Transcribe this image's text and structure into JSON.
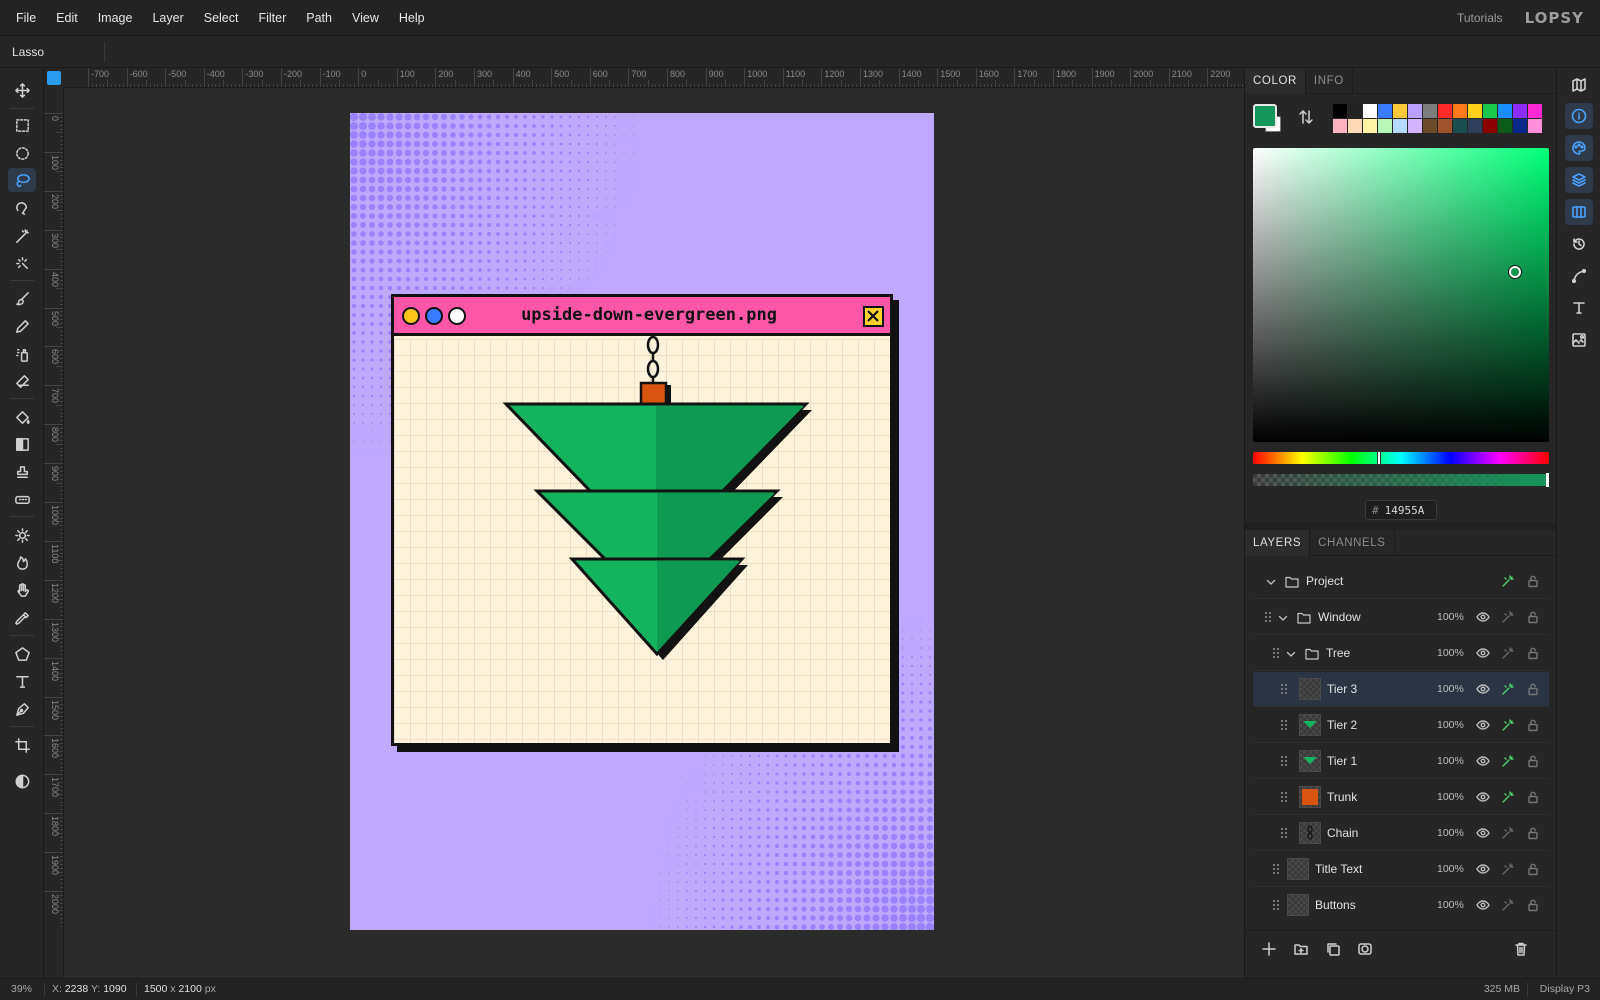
{
  "menu": {
    "items": [
      "File",
      "Edit",
      "Image",
      "Layer",
      "Select",
      "Filter",
      "Path",
      "View",
      "Help"
    ],
    "tutorials": "Tutorials",
    "logo": "LOPSY"
  },
  "options_bar": {
    "tool_name": "Lasso"
  },
  "rulers": {
    "horizontal": [
      "-700",
      "-600",
      "-500",
      "-400",
      "-300",
      "-200",
      "-100",
      "0",
      "100",
      "200",
      "300",
      "400",
      "500",
      "600",
      "700",
      "800",
      "900",
      "1000",
      "1100",
      "1200",
      "1300",
      "1400",
      "1500",
      "1600",
      "1700",
      "1800",
      "1900",
      "2000",
      "2100",
      "2200"
    ],
    "vertical": [
      "0",
      "100",
      "200",
      "300",
      "400",
      "500",
      "600",
      "700",
      "800",
      "900",
      "1000",
      "1100",
      "1200",
      "1300",
      "1400",
      "1500",
      "1600",
      "1700",
      "1800",
      "1900",
      "2000"
    ]
  },
  "toolbar": {
    "tools": [
      "move-icon",
      "rect-select-icon",
      "ellipse-select-icon",
      "lasso-icon",
      "magnetic-lasso-icon",
      "magic-wand-icon",
      "quick-select-icon",
      "brush-icon",
      "pencil-icon",
      "spray-icon",
      "eraser-icon",
      "fill-icon",
      "gradient-icon",
      "stamp-icon",
      "healing-icon",
      "dodge-icon",
      "burn-icon",
      "hand-icon",
      "eyedropper-icon",
      "polygon-icon",
      "text-icon",
      "pen-icon",
      "crop-icon",
      "contrast-icon"
    ],
    "active": "lasso-icon"
  },
  "document": {
    "window_title": "upside-down-evergreen.png",
    "colors": {
      "background": "#BFA9FF",
      "titlebar": "#FF56A8",
      "paper": "#FFF3DC",
      "tree": "#14B35F",
      "tree_dark": "#0E9A52",
      "trunk": "#D9540E",
      "outline": "#121212"
    },
    "buttons": [
      "yellow",
      "blue",
      "white"
    ]
  },
  "color_panel": {
    "tabs": [
      "COLOR",
      "INFO"
    ],
    "active_tab": "COLOR",
    "foreground": "#14955A",
    "background": "#FFFFFF",
    "hex_label": "#",
    "hex_value": "14955A",
    "palette": [
      "#000000",
      "#222222",
      "#ffffff",
      "#3b7bff",
      "#ffc83a",
      "#b9a0ff",
      "#7d7d7d",
      "#ff2a2a",
      "#ff7a1a",
      "#ffd21a",
      "#19c74a",
      "#1a8dff",
      "#8c2dff",
      "#ff2ad4",
      "#ffb3c1",
      "#ffd9b3",
      "#fff3a6",
      "#b8f5b8",
      "#b3d9ff",
      "#d4b3ff",
      "#6b4a2a",
      "#a0522d",
      "#1a4f4f",
      "#2f3f5a",
      "#8b0000",
      "#0a5c1a",
      "#0a2a8b",
      "#ff8fd8"
    ]
  },
  "layers_panel": {
    "tabs": [
      "LAYERS",
      "CHANNELS"
    ],
    "active_tab": "LAYERS",
    "layers": [
      {
        "name": "Project",
        "type": "folder",
        "depth": 0,
        "opacity": ""
      },
      {
        "name": "Window",
        "type": "folder",
        "depth": 1,
        "opacity": "100%"
      },
      {
        "name": "Tree",
        "type": "folder",
        "depth": 2,
        "opacity": "100%"
      },
      {
        "name": "Tier 3",
        "type": "layer",
        "depth": 3,
        "opacity": "100%",
        "selected": true
      },
      {
        "name": "Tier 2",
        "type": "layer",
        "depth": 3,
        "opacity": "100%"
      },
      {
        "name": "Tier 1",
        "type": "layer",
        "depth": 3,
        "opacity": "100%"
      },
      {
        "name": "Trunk",
        "type": "layer",
        "depth": 3,
        "opacity": "100%"
      },
      {
        "name": "Chain",
        "type": "layer",
        "depth": 3,
        "opacity": "100%"
      },
      {
        "name": "Title Text",
        "type": "layer",
        "depth": 2,
        "opacity": "100%"
      },
      {
        "name": "Buttons",
        "type": "layer",
        "depth": 2,
        "opacity": "100%"
      }
    ]
  },
  "status": {
    "zoom": "39%",
    "x_label": "X:",
    "x_value": "2238",
    "y_label": "Y:",
    "y_value": "1090",
    "width": "1500",
    "size_sep": "x",
    "height": "2100",
    "unit": "px",
    "memory": "325 MB",
    "color_profile": "Display P3"
  }
}
